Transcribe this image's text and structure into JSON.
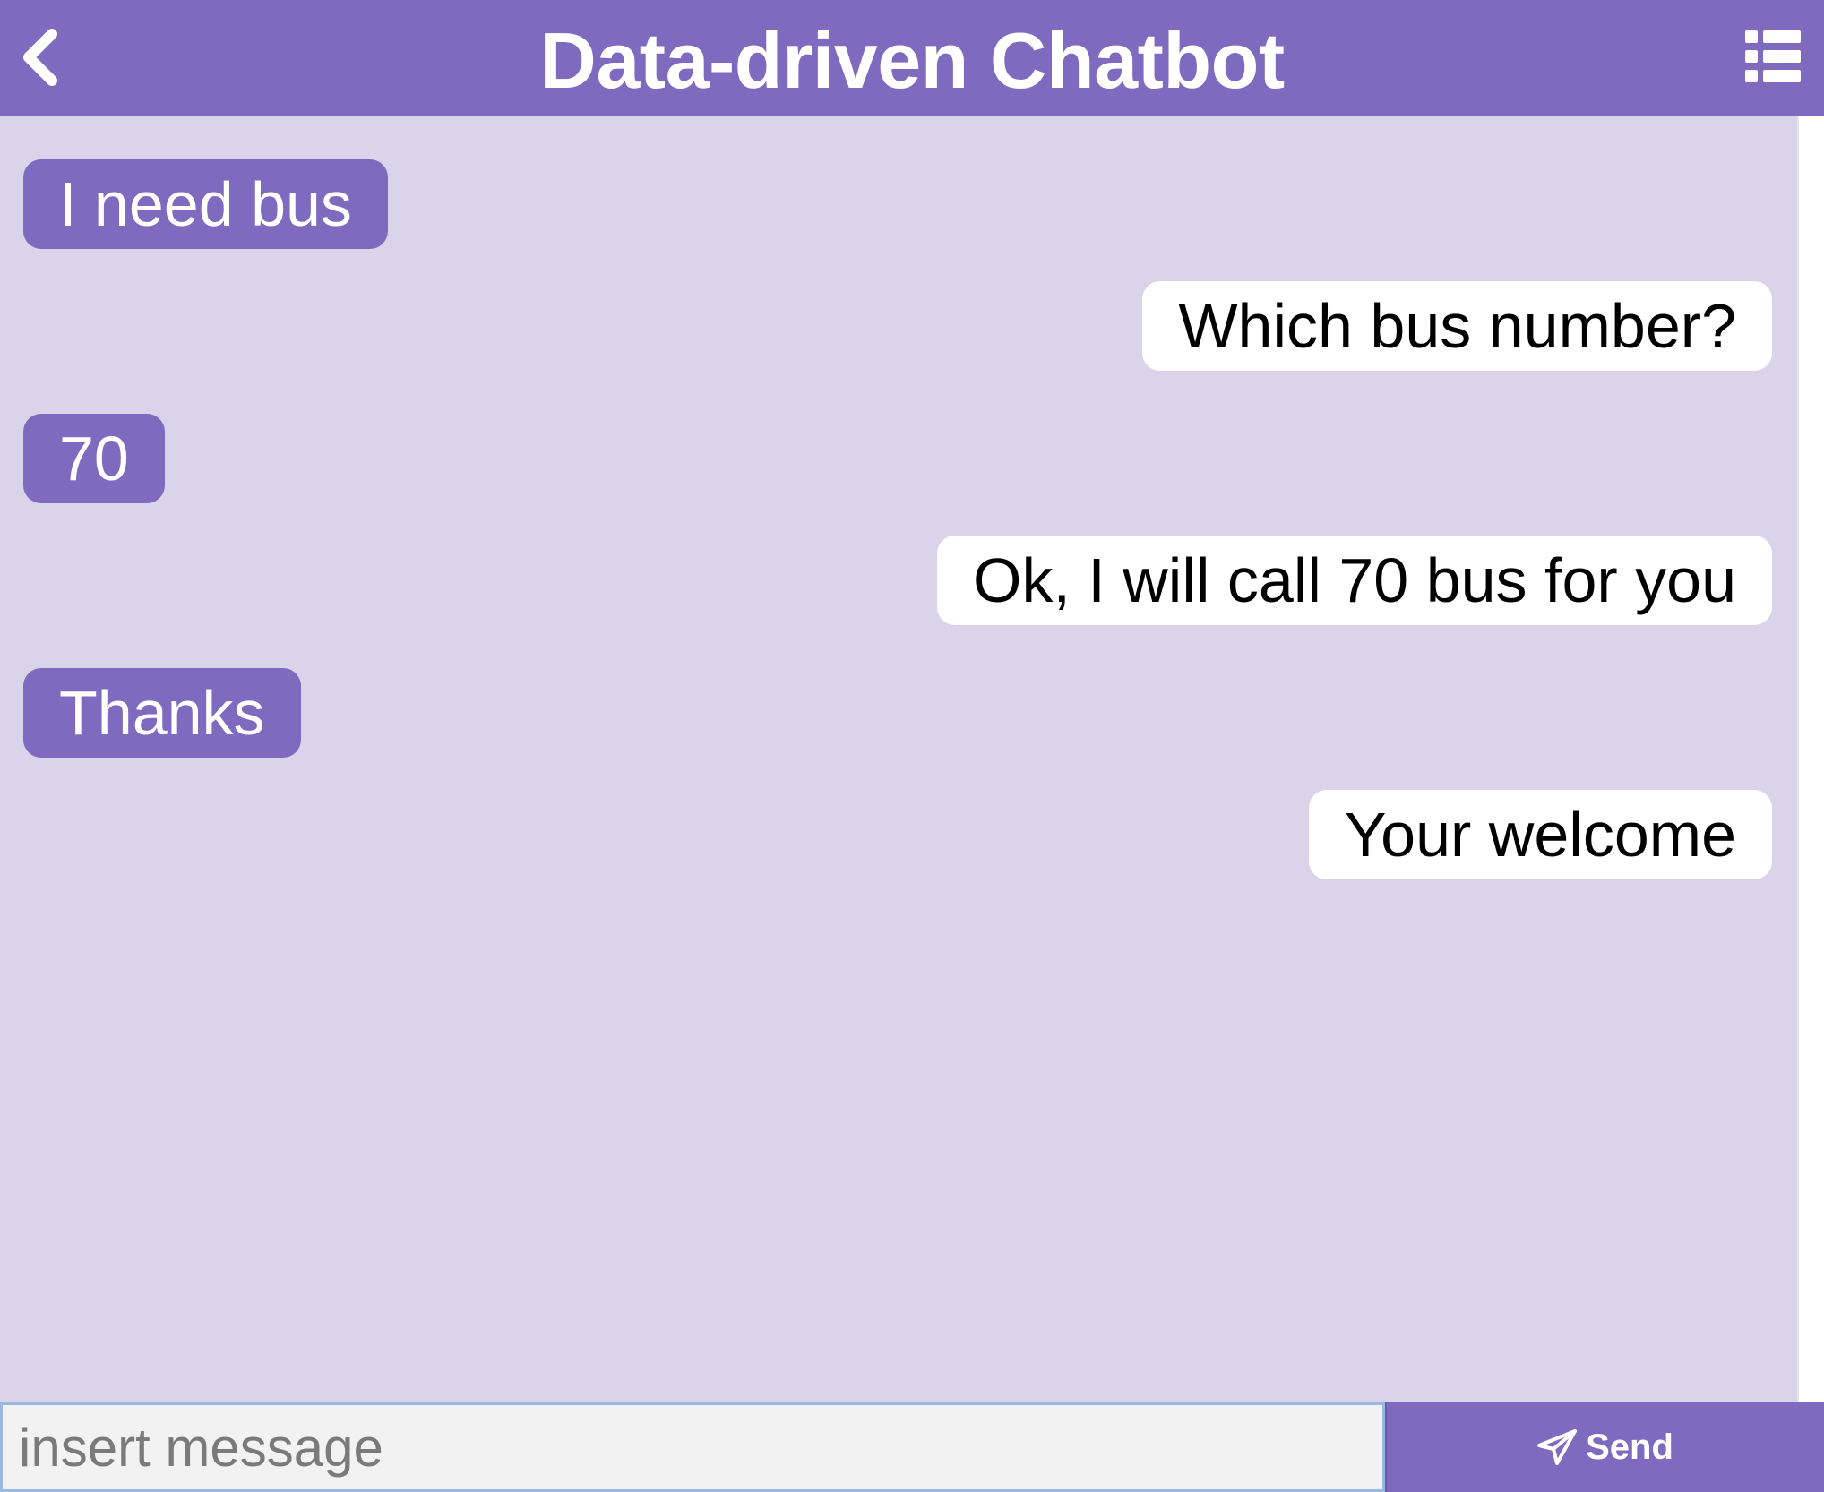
{
  "header": {
    "title": "Data-driven Chatbot",
    "back_icon": "chevron-left-icon",
    "menu_icon": "list-icon"
  },
  "colors": {
    "accent": "#7e6bbf",
    "chat_background": "#d9d4ea",
    "bot_bubble": "#ffffff",
    "input_background": "#f2f2f2"
  },
  "messages": [
    {
      "sender": "user",
      "text": "I need bus"
    },
    {
      "sender": "bot",
      "text": "Which bus number?"
    },
    {
      "sender": "user",
      "text": "70"
    },
    {
      "sender": "bot",
      "text": "Ok, I will call 70 bus for you"
    },
    {
      "sender": "user",
      "text": "Thanks"
    },
    {
      "sender": "bot",
      "text": "Your welcome"
    }
  ],
  "composer": {
    "placeholder": "insert message",
    "value": "",
    "send_label": "Send",
    "send_icon": "paper-plane-icon"
  }
}
